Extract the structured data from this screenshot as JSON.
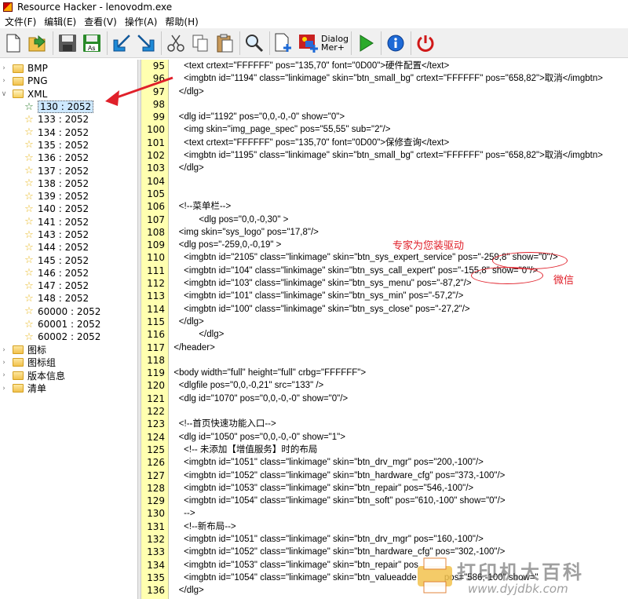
{
  "window": {
    "title": "Resource Hacker - lenovodm.exe"
  },
  "menu": [
    "文件(F)",
    "编辑(E)",
    "查看(V)",
    "操作(A)",
    "帮助(H)"
  ],
  "toolbar": {
    "dialog_label_1": "Dialog",
    "dialog_label_2": "Mer+"
  },
  "tree": {
    "top": [
      {
        "label": "BMP",
        "expanded": false
      },
      {
        "label": "PNG",
        "expanded": false
      },
      {
        "label": "XML",
        "expanded": true
      }
    ],
    "xml_children": [
      "130 : 2052",
      "133 : 2052",
      "134 : 2052",
      "135 : 2052",
      "136 : 2052",
      "137 : 2052",
      "138 : 2052",
      "139 : 2052",
      "140 : 2052",
      "141 : 2052",
      "143 : 2052",
      "144 : 2052",
      "145 : 2052",
      "146 : 2052",
      "147 : 2052",
      "148 : 2052",
      "60000 : 2052",
      "60001 : 2052",
      "60002 : 2052"
    ],
    "selected": "130 : 2052",
    "bottom": [
      {
        "label": "图标"
      },
      {
        "label": "图标组"
      },
      {
        "label": "版本信息"
      },
      {
        "label": "清单"
      }
    ]
  },
  "editor": {
    "lines": [
      {
        "n": "95",
        "t": "      <text crtext=\"FFFFFF\" pos=\"135,70\" font=\"0D00\">硬件配置</text>"
      },
      {
        "n": "96",
        "t": "      <imgbtn id=\"1194\" class=\"linkimage\" skin=\"btn_small_bg\" crtext=\"FFFFFF\" pos=\"658,82\">取消</imgbtn>"
      },
      {
        "n": "97",
        "t": "    </dlg>"
      },
      {
        "n": "98",
        "t": ""
      },
      {
        "n": "99",
        "t": "    <dlg id=\"1192\" pos=\"0,0,-0,-0\" show=\"0\">"
      },
      {
        "n": "100",
        "t": "      <img skin=\"img_page_spec\" pos=\"55,55\" sub=\"2\"/>"
      },
      {
        "n": "101",
        "t": "      <text crtext=\"FFFFFF\" pos=\"135,70\" font=\"0D00\">保修查询</text>"
      },
      {
        "n": "102",
        "t": "      <imgbtn id=\"1195\" class=\"linkimage\" skin=\"btn_small_bg\" crtext=\"FFFFFF\" pos=\"658,82\">取消</imgbtn>"
      },
      {
        "n": "103",
        "t": "    </dlg>"
      },
      {
        "n": "104",
        "t": ""
      },
      {
        "n": "105",
        "t": ""
      },
      {
        "n": "106",
        "t": "    <!--菜单栏-->"
      },
      {
        "n": "107",
        "t": "            <dlg pos=\"0,0,-0,30\" >"
      },
      {
        "n": "108",
        "t": "    <img skin=\"sys_logo\" pos=\"17,8\"/>"
      },
      {
        "n": "109",
        "t": "    <dlg pos=\"-259,0,-0,19\" >"
      },
      {
        "n": "110",
        "t": "      <imgbtn id=\"2105\" class=\"linkimage\" skin=\"btn_sys_expert_service\" pos=\"-259,8\" show=\"0\"/>"
      },
      {
        "n": "111",
        "t": "      <imgbtn id=\"104\" class=\"linkimage\" skin=\"btn_sys_call_expert\" pos=\"-155,8\" show=\"0\"/>"
      },
      {
        "n": "112",
        "t": "      <imgbtn id=\"103\" class=\"linkimage\" skin=\"btn_sys_menu\" pos=\"-87,2\"/>"
      },
      {
        "n": "113",
        "t": "      <imgbtn id=\"101\" class=\"linkimage\" skin=\"btn_sys_min\" pos=\"-57,2\"/>"
      },
      {
        "n": "114",
        "t": "      <imgbtn id=\"100\" class=\"linkimage\" skin=\"btn_sys_close\" pos=\"-27,2\"/>"
      },
      {
        "n": "115",
        "t": "    </dlg>"
      },
      {
        "n": "116",
        "t": "            </dlg>"
      },
      {
        "n": "117",
        "t": "  </header>"
      },
      {
        "n": "118",
        "t": ""
      },
      {
        "n": "119",
        "t": "  <body width=\"full\" height=\"full\" crbg=\"FFFFFF\">"
      },
      {
        "n": "120",
        "t": "    <dlgfile pos=\"0,0,-0,21\" src=\"133\" />"
      },
      {
        "n": "121",
        "t": "    <dlg id=\"1070\" pos=\"0,0,-0,-0\" show=\"0\"/>"
      },
      {
        "n": "122",
        "t": ""
      },
      {
        "n": "123",
        "t": "    <!--首页快速功能入口-->"
      },
      {
        "n": "124",
        "t": "    <dlg id=\"1050\" pos=\"0,0,-0,-0\" show=\"1\">"
      },
      {
        "n": "125",
        "t": "      <!-- 未添加【增值服务】时的布局"
      },
      {
        "n": "126",
        "t": "      <imgbtn id=\"1051\" class=\"linkimage\" skin=\"btn_drv_mgr\" pos=\"200,-100\"/>"
      },
      {
        "n": "127",
        "t": "      <imgbtn id=\"1052\" class=\"linkimage\" skin=\"btn_hardware_cfg\" pos=\"373,-100\"/>"
      },
      {
        "n": "128",
        "t": "      <imgbtn id=\"1053\" class=\"linkimage\" skin=\"btn_repair\" pos=\"546,-100\"/>"
      },
      {
        "n": "129",
        "t": "      <imgbtn id=\"1054\" class=\"linkimage\" skin=\"btn_soft\" pos=\"610,-100\" show=\"0\"/>"
      },
      {
        "n": "130",
        "t": "      -->"
      },
      {
        "n": "131",
        "t": "      <!--新布局-->"
      },
      {
        "n": "132",
        "t": "      <imgbtn id=\"1051\" class=\"linkimage\" skin=\"btn_drv_mgr\" pos=\"160,-100\"/>"
      },
      {
        "n": "133",
        "t": "      <imgbtn id=\"1052\" class=\"linkimage\" skin=\"btn_hardware_cfg\" pos=\"302,-100\"/>"
      },
      {
        "n": "134",
        "t": "      <imgbtn id=\"1053\" class=\"linkimage\" skin=\"btn_repair\" pos"
      },
      {
        "n": "135",
        "t": "      <imgbtn id=\"1054\" class=\"linkimage\" skin=\"btn_valueadde           pos=\"586,-100\" show=\""
      },
      {
        "n": "136",
        "t": "    </dlg>"
      }
    ]
  },
  "annotations": {
    "expert_label": "专家为您装驱动",
    "wechat_label": "微信"
  },
  "watermark": {
    "brand": "打印机大百科",
    "url": "www.dyjdbk.com"
  },
  "colors": {
    "gutter": "#ffffb0",
    "annotation": "#e0202a"
  }
}
